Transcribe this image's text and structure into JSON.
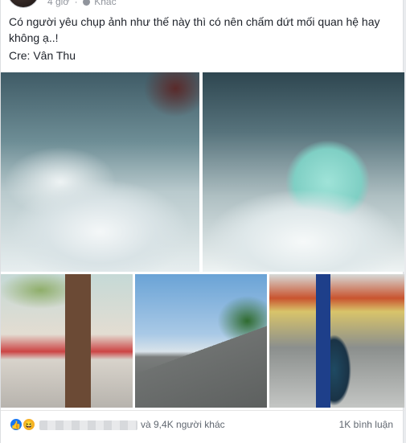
{
  "post": {
    "meta_time": "4 giờ",
    "meta_privacy": "Khác",
    "text": "Có người yêu chụp ảnh như thế này thì có nên chấm dứt mối quan hệ hay không ạ..!",
    "credit": "Cre: Vân Thu"
  },
  "photos": [
    {
      "subject": "woman-in-wave-sunglasses"
    },
    {
      "subject": "woman-in-mint-shirt-wave"
    },
    {
      "subject": "street-with-tree"
    },
    {
      "subject": "beach-road"
    },
    {
      "subject": "woman-in-hijab-gas-station"
    }
  ],
  "reactions": {
    "icons": [
      "like-icon",
      "haha-icon"
    ],
    "others_text": "và 9,4K người khác",
    "comments_text": "1K bình luận",
    "like_color": "#1877f2",
    "haha_color": "#f7b125"
  }
}
